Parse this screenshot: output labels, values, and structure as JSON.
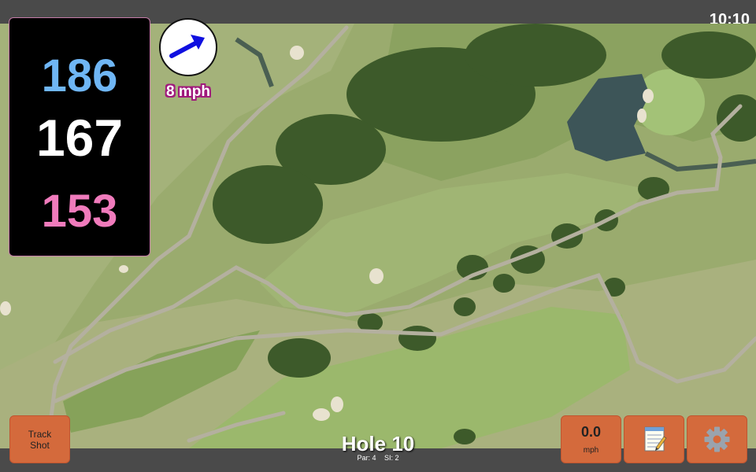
{
  "status": {
    "time": "10:10"
  },
  "distances": {
    "back": "186",
    "center": "167",
    "front": "153"
  },
  "wind": {
    "speed": "8 mph",
    "icon": "wind-arrow-icon"
  },
  "buttons": {
    "track_shot_line1": "Track",
    "track_shot_line2": "Shot",
    "speed_value": "0.0",
    "speed_unit": "mph",
    "notes_icon": "notepad-icon",
    "settings_icon": "gear-icon"
  },
  "hole": {
    "title": "Hole 10",
    "par": "Par: 4",
    "si": "SI: 2"
  },
  "colors": {
    "back": "#6fb6f5",
    "center": "#ffffff",
    "front": "#f07bbc",
    "button": "#d46a3c",
    "wind_arrow": "#1010e0"
  }
}
